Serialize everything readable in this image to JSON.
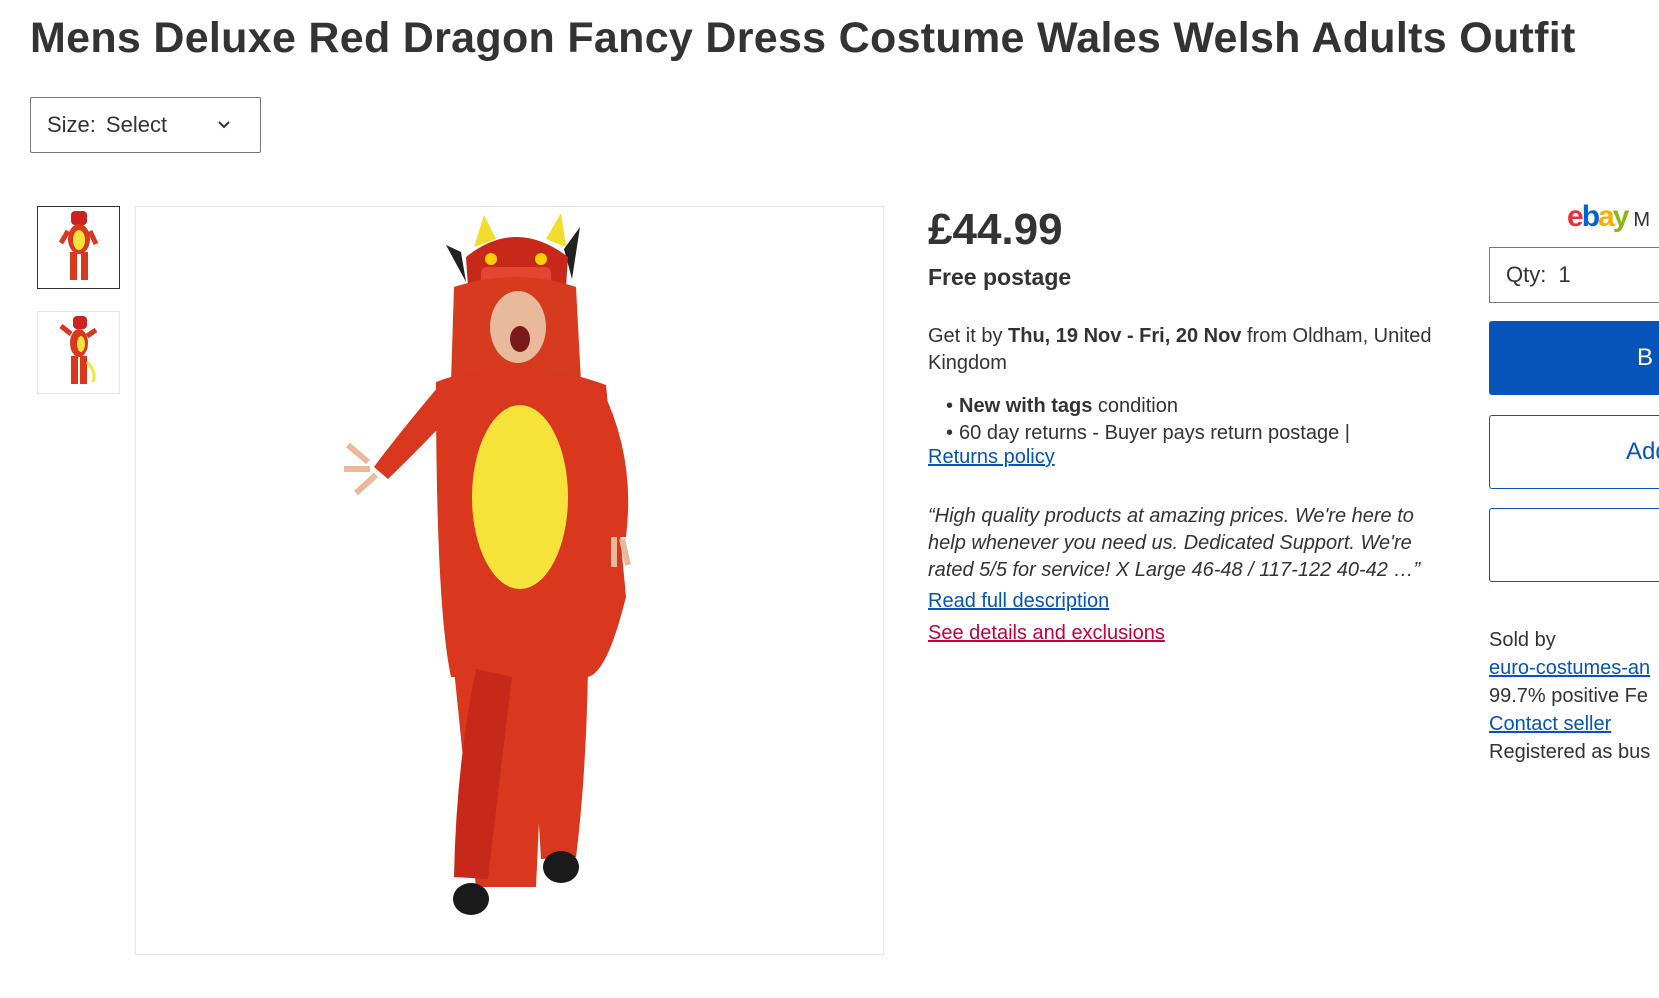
{
  "title": "Mens Deluxe Red Dragon Fancy Dress Costume Wales Welsh Adults Outfit",
  "size": {
    "label": "Size:",
    "value": "Select"
  },
  "gallery": {
    "thumbnails": [
      "dragon-costume-front",
      "dragon-costume-side"
    ],
    "selected_index": 0
  },
  "pricing": {
    "price": "£44.99",
    "postage": "Free postage"
  },
  "delivery": {
    "prefix": "Get it by ",
    "dates": "Thu, 19 Nov - Fri, 20 Nov",
    "suffix": " from Oldham, United Kingdom"
  },
  "condition": {
    "bold": "New with tags",
    "suffix": " condition"
  },
  "returns": {
    "text": "60 day returns - Buyer pays return postage |",
    "link": "Returns policy"
  },
  "description_excerpt": "“High quality products at amazing prices. We're here to help whenever you need us. Dedicated Support. We're rated 5/5 for service! X Large 46-48 / 117-122 40-42 …”",
  "links": {
    "read_full": "Read full description",
    "see_details": "See details and exclusions"
  },
  "buy_box": {
    "logo": {
      "e": "e",
      "b": "b",
      "a": "a",
      "y": "y",
      "suffix": "M"
    },
    "qty_label": "Qty:",
    "qty_value": "1",
    "buy_label": "B",
    "add_label": "Add",
    "third_label": ""
  },
  "seller": {
    "sold_by": "Sold by",
    "name": "euro-costumes-an",
    "feedback": "99.7% positive Fe",
    "contact": "Contact seller",
    "registered": "Registered as bus"
  },
  "colors": {
    "text": "#333333",
    "link_blue": "#0654ba",
    "link_red": "#c6003a",
    "costume_red": "#d9371e",
    "belly_yellow": "#f6e33a"
  }
}
